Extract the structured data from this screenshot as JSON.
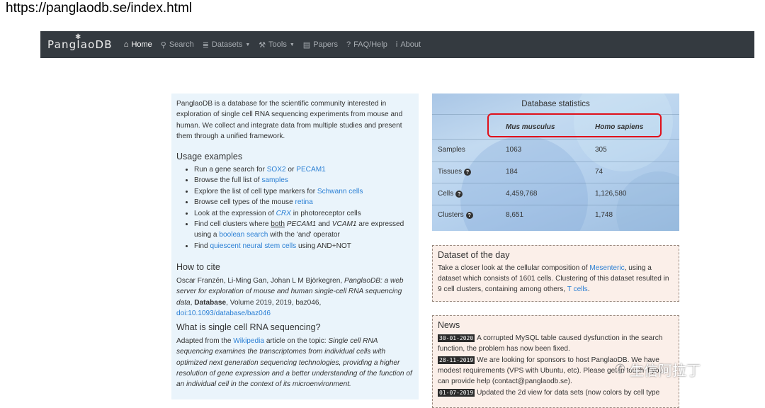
{
  "url_caption": "https://panglaodb.se/index.html",
  "nav": {
    "brand": "PanglaoDB",
    "items": [
      {
        "label": "Home",
        "icon": "home-icon",
        "glyph": "⌂",
        "active": true,
        "dropdown": false
      },
      {
        "label": "Search",
        "icon": "search-icon",
        "glyph": "⚲",
        "active": false,
        "dropdown": false
      },
      {
        "label": "Datasets",
        "icon": "database-icon",
        "glyph": "≣",
        "active": false,
        "dropdown": true
      },
      {
        "label": "Tools",
        "icon": "wrench-icon",
        "glyph": "⚒",
        "active": false,
        "dropdown": true
      },
      {
        "label": "Papers",
        "icon": "newspaper-icon",
        "glyph": "▤",
        "active": false,
        "dropdown": false
      },
      {
        "label": "FAQ/Help",
        "icon": "question-icon",
        "glyph": "?",
        "active": false,
        "dropdown": false
      },
      {
        "label": "About",
        "icon": "info-icon",
        "glyph": "i",
        "active": false,
        "dropdown": false
      }
    ]
  },
  "intro": "PanglaoDB is a database for the scientific community interested in exploration of single cell RNA sequencing experiments from mouse and human. We collect and integrate data from multiple studies and present them through a unified framework.",
  "usage": {
    "title": "Usage examples",
    "items": [
      [
        {
          "t": "Run a gene search for "
        },
        {
          "t": "SOX2",
          "link": true
        },
        {
          "t": " or "
        },
        {
          "t": "PECAM1",
          "link": true
        }
      ],
      [
        {
          "t": "Browse the full list of "
        },
        {
          "t": "samples",
          "link": true
        }
      ],
      [
        {
          "t": "Explore the list of cell type markers for "
        },
        {
          "t": "Schwann cells",
          "link": true
        }
      ],
      [
        {
          "t": "Browse cell types of the mouse "
        },
        {
          "t": "retina",
          "link": true
        }
      ],
      [
        {
          "t": "Look at the expression of "
        },
        {
          "t": "CRX",
          "link": true,
          "italic": true
        },
        {
          "t": " in photoreceptor cells"
        }
      ],
      [
        {
          "t": "Find cell clusters where "
        },
        {
          "t": "both",
          "underline": true
        },
        {
          "t": " "
        },
        {
          "t": "PECAM1",
          "italic": true
        },
        {
          "t": " and "
        },
        {
          "t": "VCAM1",
          "italic": true
        },
        {
          "t": " are expressed using a "
        },
        {
          "t": "boolean search",
          "link": true
        },
        {
          "t": " with the 'and' operator"
        }
      ],
      [
        {
          "t": "Find "
        },
        {
          "t": "quiescent neural stem cells",
          "link": true
        },
        {
          "t": " using AND+NOT"
        }
      ]
    ]
  },
  "cite": {
    "title": "How to cite",
    "parts": [
      {
        "t": "Oscar Franzén, Li-Ming Gan, Johan L M Björkegren, "
      },
      {
        "t": "PanglaoDB: a web server for exploration of mouse and human single-cell RNA sequencing data",
        "italic": true
      },
      {
        "t": ", "
      },
      {
        "t": "Database",
        "bold": true
      },
      {
        "t": ", Volume 2019, 2019, baz046, "
      },
      {
        "t": "doi:10.1093/database/baz046",
        "link": true
      }
    ]
  },
  "scrna": {
    "title": "What is single cell RNA sequencing?",
    "parts": [
      {
        "t": "Adapted from the "
      },
      {
        "t": "Wikipedia",
        "link": true
      },
      {
        "t": " article on the topic: "
      },
      {
        "t": "Single cell RNA sequencing examines the transcriptomes from individual cells with optimized next generation sequencing technologies, providing a higher resolution of gene expression and a better understanding of the function of an individual cell in the context of its microenvironment.",
        "italic": true
      }
    ]
  },
  "stats": {
    "title": "Database statistics",
    "species": [
      "Mus musculus",
      "Homo sapiens"
    ],
    "rows": [
      {
        "label": "Samples",
        "help": false,
        "values": [
          "1063",
          "305"
        ],
        "link": true
      },
      {
        "label": "Tissues",
        "help": true,
        "values": [
          "184",
          "74"
        ],
        "link": false
      },
      {
        "label": "Cells",
        "help": true,
        "values": [
          "4,459,768",
          "1,126,580"
        ],
        "link": false
      },
      {
        "label": "Clusters",
        "help": true,
        "values": [
          "8,651",
          "1,748"
        ],
        "link": false
      }
    ]
  },
  "dataset_day": {
    "title": "Dataset of the day",
    "parts": [
      {
        "t": "Take a closer look at the cellular composition of "
      },
      {
        "t": "Mesenteric",
        "link": true
      },
      {
        "t": ", using a dataset which consists of 1601 cells. Clustering of this dataset resulted in 9 cell clusters, containing among others, "
      },
      {
        "t": "T cells",
        "link": true
      },
      {
        "t": "."
      }
    ]
  },
  "news": {
    "title": "News",
    "items": [
      {
        "date": "30-01-2020",
        "text": "A corrupted MySQL table caused dysfunction in the search function, the problem has now been fixed."
      },
      {
        "date": "28-11-2019",
        "text": "We are looking for sponsors to host PanglaoDB. We have modest requirements (VPS with Ubuntu, etc). Please get in touch if you can provide help (contact@panglaodb.se)."
      },
      {
        "date": "01-07-2019",
        "text": "Updated the 2d view for data sets (now colors by cell type"
      }
    ]
  },
  "watermark": "生信阿拉丁"
}
